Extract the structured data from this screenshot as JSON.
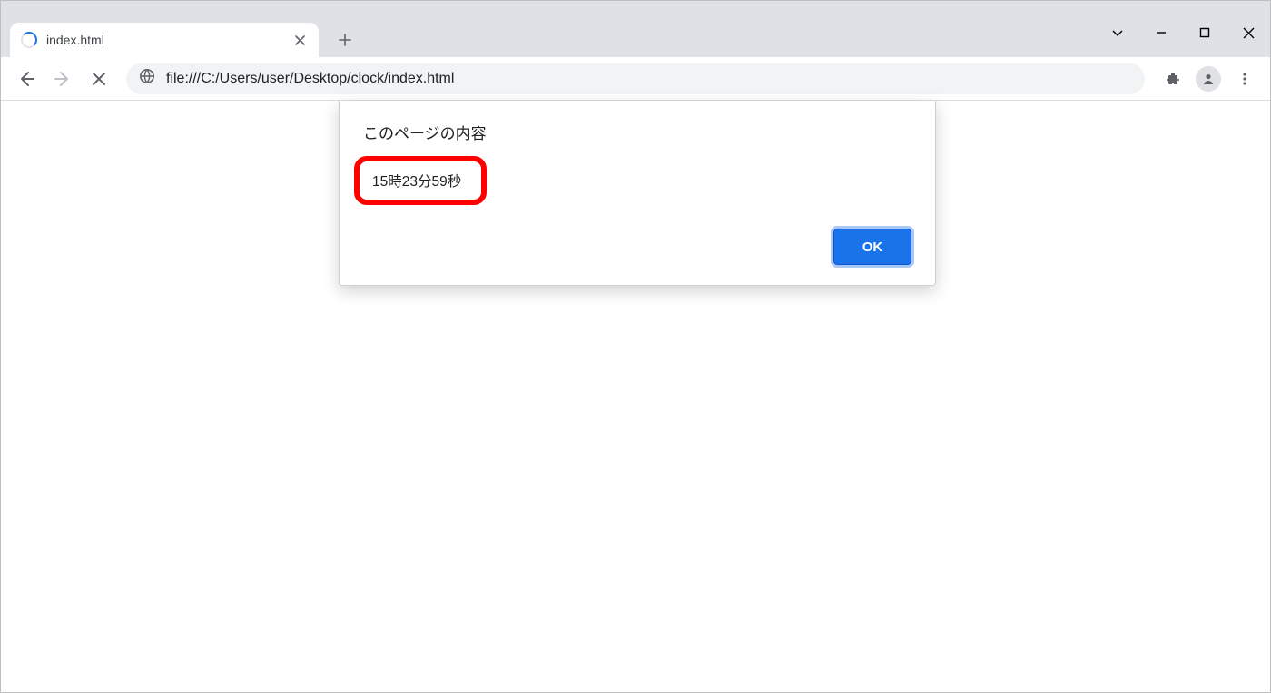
{
  "tab": {
    "title": "index.html"
  },
  "omnibox": {
    "url": "file:///C:/Users/user/Desktop/clock/index.html"
  },
  "dialog": {
    "title": "このページの内容",
    "message": "15時23分59秒",
    "ok_label": "OK"
  }
}
